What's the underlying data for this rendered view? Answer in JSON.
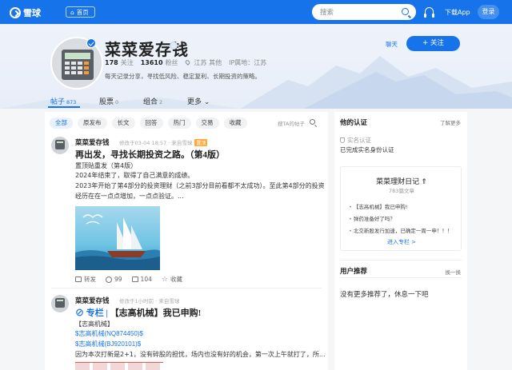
{
  "topbar": {
    "logo": "雪球",
    "home": "首页",
    "search_placeholder": "搜索",
    "download": "下载App",
    "login": "登录",
    "brand_color": "#1773ea"
  },
  "profile": {
    "name": "菜菜爱存钱",
    "following_count": "178",
    "following_label": "关注",
    "followers_count": "13610",
    "followers_label": "粉丝",
    "location": "江苏 其他",
    "ip": "IP属地：江苏",
    "bio": "每天记录分享，寻找低风险、稳定复利、长期投资的策略。",
    "chat": "聊天",
    "follow": "+ 关注"
  },
  "tabs": [
    {
      "label": "帖子",
      "count": "873"
    },
    {
      "label": "股票",
      "count": "0"
    },
    {
      "label": "组合",
      "count": "2"
    },
    {
      "label": "更多",
      "count": ""
    }
  ],
  "filters": [
    "全部",
    "原发布",
    "长文",
    "回答",
    "热门",
    "交易",
    "收藏"
  ],
  "post_search": "搜TA的帖子",
  "posts": [
    {
      "author": "菜菜爱存钱",
      "meta": "修改于03-04 18:57 · 来自雪球",
      "pinned": "置顶",
      "title": "再出发，寻找长期投资之路。（第4版）",
      "lines": [
        "置顶贴重发（第4版）",
        "2024年结束了，取得了自己满意的成绩。",
        "2023年开始了第4部分的投资理财（之前3部分目前看都不太成功）。至此第4部分的投资",
        "经历在在一点点增加，一点点验证。..."
      ],
      "actions": {
        "repost": "转发",
        "comments": "99",
        "likes": "104",
        "favorite": "收藏"
      }
    },
    {
      "author": "菜菜爱存钱",
      "meta": "修改于1小时前 · 来自雪球",
      "column_tag": "专栏 |",
      "title": "【志高机械】我已申购!",
      "lines": [
        "【志高机械】",
        "$志高机械(NQ874450)$",
        "$志高机械(BJ920101)$",
        "因为本次打新是2+1，没有碎股的担忧，场内也没有好的机会，第一次上午就打了，所..."
      ]
    }
  ],
  "sidebar": {
    "auth_title": "他的认证",
    "auth_more": "了解更多",
    "auth_label": "实名认证",
    "auth_text": "已完成实名身份认证",
    "column": {
      "title": "菜菜理财日记",
      "sub": "783篇文章",
      "items": [
        "【志高机械】我已申购!",
        "弹药准备好了吗？",
        "北交新股发行加速，已确定一周一申！！！"
      ],
      "enter": "进入专栏 >"
    },
    "recommend_title": "用户推荐",
    "recommend_more": "换一换",
    "recommend_empty": "没有更多推荐了，休息一下吧"
  }
}
